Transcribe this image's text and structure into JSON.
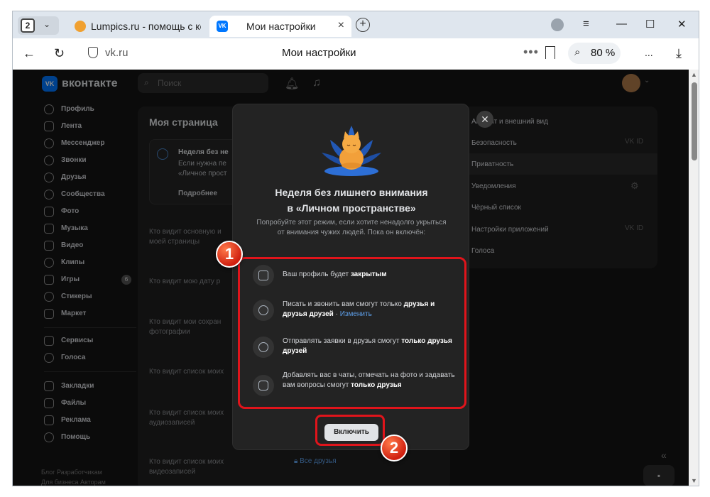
{
  "browser": {
    "tab_count": "2",
    "tabs": [
      {
        "title": "Lumpics.ru - помощь с ком"
      },
      {
        "title": "Мои настройки"
      }
    ],
    "url_domain": "vk.ru",
    "page_title": "Мои настройки",
    "zoom": "80 %",
    "window_buttons": {
      "menu": "≡",
      "minimize": "—",
      "maximize": "☐",
      "close": "✕"
    }
  },
  "vk": {
    "logo_text": "вконтакте",
    "search_placeholder": "Поиск",
    "nav": [
      {
        "label": "Профиль"
      },
      {
        "label": "Лента"
      },
      {
        "label": "Мессенджер"
      },
      {
        "label": "Звонки"
      },
      {
        "label": "Друзья"
      },
      {
        "label": "Сообщества"
      },
      {
        "label": "Фото"
      },
      {
        "label": "Музыка"
      },
      {
        "label": "Видео"
      },
      {
        "label": "Клипы"
      },
      {
        "label": "Игры",
        "badge": "6"
      },
      {
        "label": "Стикеры"
      },
      {
        "label": "Маркет"
      }
    ],
    "nav2": [
      {
        "label": "Сервисы"
      },
      {
        "label": "Голоса"
      }
    ],
    "nav3": [
      {
        "label": "Закладки"
      },
      {
        "label": "Файлы"
      },
      {
        "label": "Реклама"
      },
      {
        "label": "Помощь"
      }
    ],
    "footer": {
      "line1": "Блог   Разработчикам",
      "line2": "Для бизнеса   Авторам"
    },
    "center": {
      "title": "Моя страница",
      "notice_title": "Неделя без не",
      "notice_line1": "Если нужна пе",
      "notice_line2": "«Личное прост",
      "notice_more": "Подробнее",
      "rows": [
        {
          "l1": "Кто видит основную и",
          "l2": "моей страницы"
        },
        {
          "l1": "Кто видит мою дату р",
          "l2": ""
        },
        {
          "l1": "Кто видит мои сохран",
          "l2": "фотографии"
        },
        {
          "l1": "Кто видит список моих",
          "l2": ""
        },
        {
          "l1": "Кто видит список моих",
          "l2": "аудиозаписей"
        },
        {
          "l1": "Кто видит список моих",
          "l2": "видеозаписей"
        }
      ],
      "last_value": "Все друзья"
    },
    "settings_menu": [
      {
        "label": "Аккаунт и внешний вид"
      },
      {
        "label": "Безопасность",
        "tag": "ID"
      },
      {
        "label": "Приватность"
      },
      {
        "label": "Уведомления"
      },
      {
        "label": "Чёрный список"
      },
      {
        "label": "Настройки приложений",
        "tag": "ID"
      },
      {
        "label": "Голоса"
      }
    ]
  },
  "modal": {
    "title_line1": "Неделя без лишнего внимания",
    "title_line2": "в «Личном пространстве»",
    "subtitle": "Попробуйте этот режим, если хотите ненадолго укрыться от внимания чужих людей. Пока он включён:",
    "features": [
      {
        "text": "Ваш профиль будет ",
        "bold": "закрытым",
        "icon": "lock-icon"
      },
      {
        "text": "Писать и звонить вам смогут только ",
        "bold": "друзья и друзья друзей",
        "link": "Изменить",
        "icon": "message-icon"
      },
      {
        "text": "Отправлять заявки в друзья смогут ",
        "bold": "только друзья друзей",
        "icon": "users-icon"
      },
      {
        "text": "Добавлять вас в чаты, отмечать на фото и задавать вам вопросы смогут ",
        "bold": "только друзья",
        "icon": "image-icon"
      }
    ],
    "button": "Включить"
  },
  "annotations": {
    "badge1": "1",
    "badge2": "2",
    "color": "#e0141b"
  }
}
